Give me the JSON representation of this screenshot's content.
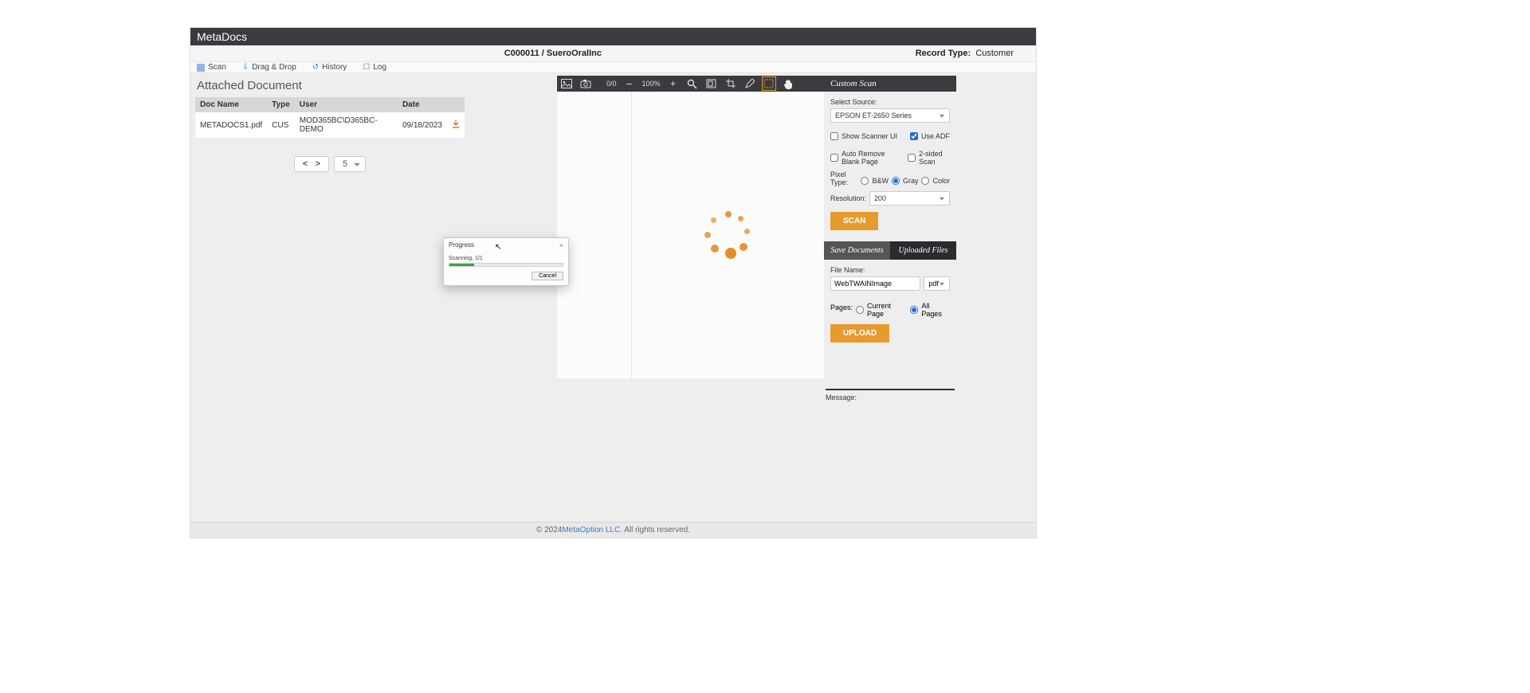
{
  "app_title": "MetaDocs",
  "record": {
    "id": "C000011",
    "name": "SueroOralInc",
    "type_label": "Record Type:",
    "type_value": "Customer"
  },
  "tabs": {
    "scan": "Scan",
    "dragdrop": "Drag & Drop",
    "history": "History",
    "log": "Log"
  },
  "attached": {
    "heading": "Attached Document",
    "cols": {
      "doc": "Doc Name",
      "type": "Type",
      "user": "User",
      "date": "Date"
    },
    "rows": [
      {
        "doc": "METADOCS1.pdf",
        "type": "CUS",
        "user": "MOD365BC\\D365BC-DEMO",
        "date": "09/18/2023"
      }
    ],
    "pager": {
      "prev": "<",
      "next": ">",
      "size": "5"
    }
  },
  "viewer": {
    "page_indicator": "0/0",
    "zoom": "100%"
  },
  "custom_scan": {
    "heading": "Custom Scan",
    "select_source_label": "Select Source:",
    "source": "EPSON ET-2650 Series",
    "show_scanner_ui": "Show Scanner UI",
    "use_adf": "Use ADF",
    "auto_remove_blank": "Auto Remove Blank Page",
    "two_sided": "2-sided Scan",
    "pixel_type_label": "Pixel Type:",
    "bw": "B&W",
    "gray": "Gray",
    "color": "Color",
    "resolution_label": "Resolution:",
    "resolution": "200",
    "scan_btn": "SCAN"
  },
  "save": {
    "tab_save": "Save Documents",
    "tab_uploaded": "Uploaded Files",
    "file_name_label": "File Name:",
    "file_name": "WebTWAINImage",
    "format": "pdf",
    "pages_label": "Pages:",
    "current_page": "Current Page",
    "all_pages": "All Pages",
    "upload_btn": "UPLOAD"
  },
  "message_label": "Message:",
  "footer": {
    "copyright_prefix": "© 2024 ",
    "company": "MetaOption LLC",
    "copyright_suffix": ". All rights reserved."
  },
  "dialog": {
    "title": "Progress",
    "status": "Scanning, 1/1",
    "cancel": "Cancel"
  }
}
